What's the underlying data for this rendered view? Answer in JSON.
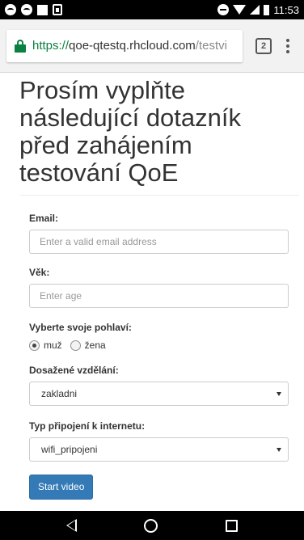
{
  "status_bar": {
    "time": "11:53"
  },
  "browser": {
    "url_scheme": "https://",
    "url_host": "qoe-qtestq.rhcloud.com",
    "url_path": "/testvi",
    "tab_count": "2"
  },
  "page": {
    "title": "Prosím vyplňte následující dotazník před zahájením testování QoE"
  },
  "form": {
    "email": {
      "label": "Email:",
      "placeholder": "Enter a valid email address",
      "value": ""
    },
    "age": {
      "label": "Věk:",
      "placeholder": "Enter age",
      "value": ""
    },
    "gender": {
      "label": "Vyberte svoje pohlaví:",
      "options": [
        "muž",
        "žena"
      ],
      "selected": "muž"
    },
    "education": {
      "label": "Dosažené vzdělání:",
      "selected": "zakladni"
    },
    "connection": {
      "label": "Typ připojení k internetu:",
      "selected": "wifi_pripojeni"
    },
    "submit_label": "Start video"
  },
  "colors": {
    "primary_button": "#337ab7",
    "secure_green": "#0b8043",
    "text": "#333333"
  },
  "icons": {
    "status_left": [
      "messenger-icon",
      "messenger-icon",
      "notification-square-icon",
      "sim-icon"
    ],
    "status_right": [
      "do-not-disturb-icon",
      "wifi-icon",
      "signal-icon",
      "battery-icon"
    ],
    "browser": [
      "lock-icon",
      "tab-switcher-icon",
      "overflow-menu-icon"
    ],
    "navigation": [
      "back-icon",
      "home-icon",
      "recent-apps-icon"
    ]
  }
}
